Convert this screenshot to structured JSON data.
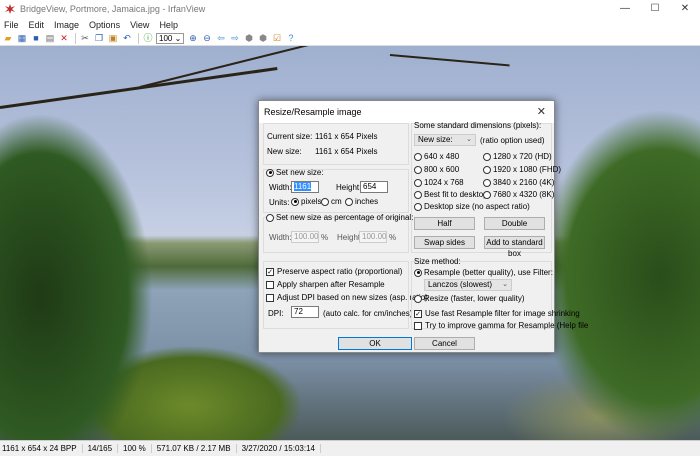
{
  "window": {
    "title": "BridgeView, Portmore, Jamaica.jpg - IrfanView",
    "minimize": "—",
    "maximize": "☐",
    "close": "✕"
  },
  "menu": [
    "File",
    "Edit",
    "Image",
    "Options",
    "View",
    "Help"
  ],
  "toolbar": {
    "zoom_value": "100"
  },
  "status": [
    "1161 x 654 x 24 BPP",
    "14/165",
    "100 %",
    "571.07 KB / 2.17 MB",
    "3/27/2020 / 15:03:14"
  ],
  "dialog": {
    "title": "Resize/Resample image",
    "close": "✕",
    "current_size_label": "Current size:",
    "current_size": "1161  x  654  Pixels",
    "new_size_label": "New size:",
    "new_size": "1161  x  654  Pixels",
    "set_new_size": "Set new size:",
    "width_label": "Width:",
    "width": "1161",
    "height_label": "Height:",
    "height": "654",
    "units_label": "Units:",
    "units": [
      "pixels",
      "cm",
      "inches"
    ],
    "set_percentage": "Set new size as percentage of original:",
    "pct_width_label": "Width:",
    "pct_width": "100.00",
    "pct_height_label": "Height:",
    "pct_height": "100.00",
    "pct_unit": "%",
    "preserve_aspect": "Preserve aspect ratio (proportional)",
    "apply_sharpen": "Apply sharpen after Resample",
    "adjust_dpi": "Adjust DPI based on new sizes (asp. ratio)",
    "dpi_label": "DPI:",
    "dpi": "72",
    "dpi_note": "(auto calc. for cm/inches)",
    "std_dims_label": "Some standard dimensions (pixels):",
    "std_select": "New size:",
    "ratio_note": "(ratio option used)",
    "std_options": [
      "640 x 480",
      "1280 x 720  (HD)",
      "800 x 600",
      "1920 x 1080 (FHD)",
      "1024 x 768",
      "3840 x 2160 (4K)",
      "Best fit to desktop",
      "7680 x 4320 (8K)"
    ],
    "desktop_size": "Desktop size (no aspect ratio)",
    "half": "Half",
    "double": "Double",
    "swap": "Swap sides",
    "add_std": "Add to standard box",
    "size_method": "Size method:",
    "resample": "Resample (better quality), use Filter:",
    "filter": "Lanczos (slowest)",
    "resize": "Resize (faster, lower quality)",
    "fast_resample": "Use fast Resample filter for image shrinking",
    "improve_gamma": "Try to improve gamma for Resample (Help file",
    "ok": "OK",
    "cancel": "Cancel"
  }
}
